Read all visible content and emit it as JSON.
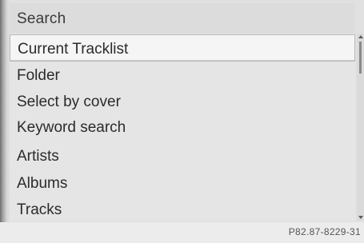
{
  "header": {
    "title": "Search"
  },
  "menu": {
    "selected_index": 0,
    "items": [
      {
        "label": "Current Tracklist"
      },
      {
        "label": "Folder"
      },
      {
        "label": "Select by cover"
      },
      {
        "label": "Keyword search"
      },
      {
        "label": "Artists"
      },
      {
        "label": "Albums"
      },
      {
        "label": "Tracks"
      }
    ]
  },
  "footer": {
    "figure_code": "P82.87-8229-31"
  },
  "icons": {
    "scroll_up": "scroll-up-arrow-icon",
    "scroll_down": "scroll-down-arrow-icon"
  },
  "colors": {
    "background": "#e1e1e1",
    "selected_row": "#f5f5f5",
    "text": "#2b2b2b"
  }
}
